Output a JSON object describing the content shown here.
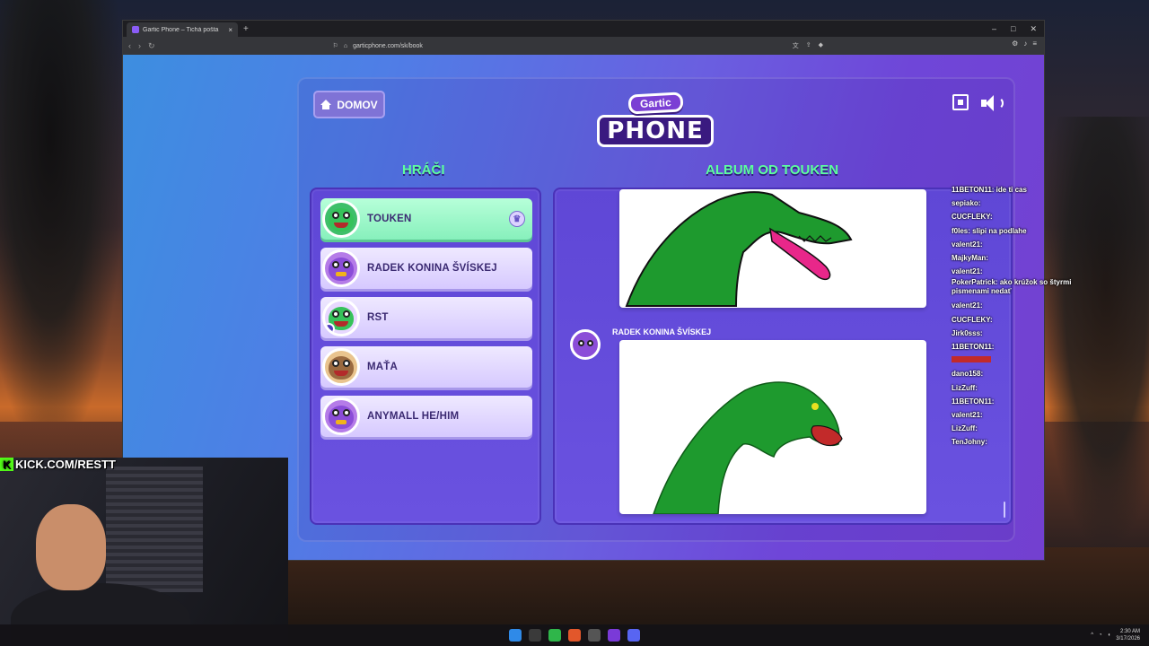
{
  "browser": {
    "tab_title": "Gartic Phone – Tichá pošta",
    "new_tab": "+",
    "url": "garticphone.com/sk/book",
    "window_controls": [
      "–",
      "□",
      "✕"
    ]
  },
  "game": {
    "home_button": "DOMOV",
    "logo": {
      "top": "Gartic",
      "main": "PHONE"
    },
    "players_heading": "HRÁČI",
    "album_heading": "ALBUM OD TOUKEN",
    "players": [
      {
        "name": "TOUKEN",
        "active": true,
        "avatar": "green-frog"
      },
      {
        "name": "RADEK KONINA ŠVÍSKEJ",
        "active": false,
        "avatar": "purple-bird"
      },
      {
        "name": "RST",
        "active": false,
        "avatar": "green-frog"
      },
      {
        "name": "MAŤA",
        "active": false,
        "avatar": "brown-bear"
      },
      {
        "name": "ANYMALL HE/HIM",
        "active": false,
        "avatar": "purple-bird"
      }
    ],
    "album_entry_author": "RADEK KONINA ŠVÍSKEJ",
    "colors": {
      "heading": "#5cff9d",
      "active_player": "#87f0bc",
      "drawing_green": "#1e9a2e",
      "tongue": "#e8278a"
    }
  },
  "stream": {
    "kick_label": "KICK.COM/RESTT",
    "chat": [
      {
        "user": "11BETON11:",
        "msg": "ide ti cas"
      },
      {
        "user": "sepiako:",
        "msg": ""
      },
      {
        "user": "CUCFLEKY:",
        "msg": ""
      },
      {
        "user": "f0les:",
        "msg": "slipi na podlahe"
      },
      {
        "user": "valent21:",
        "msg": ""
      },
      {
        "user": "MajkyMan:",
        "msg": ""
      },
      {
        "user": "valent21:",
        "msg": ""
      },
      {
        "user": "PokerPatrick:",
        "msg": "ako krúžok so štyrmi pismenami nedať"
      },
      {
        "user": "valent21:",
        "msg": ""
      },
      {
        "user": "CUCFLEKY:",
        "msg": ""
      },
      {
        "user": "Jirk0sss:",
        "msg": ""
      },
      {
        "user": "11BETON11:",
        "msg": ""
      },
      {
        "user": "",
        "msg": ""
      },
      {
        "user": "dano158:",
        "msg": ""
      },
      {
        "user": "LizZuff:",
        "msg": ""
      },
      {
        "user": "11BETON11:",
        "msg": ""
      },
      {
        "user": "valent21:",
        "msg": ""
      },
      {
        "user": "LizZuff:",
        "msg": ""
      },
      {
        "user": "TenJohny:",
        "msg": ""
      }
    ]
  },
  "taskbar": {
    "time": "2:30 AM",
    "date": "3/17/2026"
  }
}
